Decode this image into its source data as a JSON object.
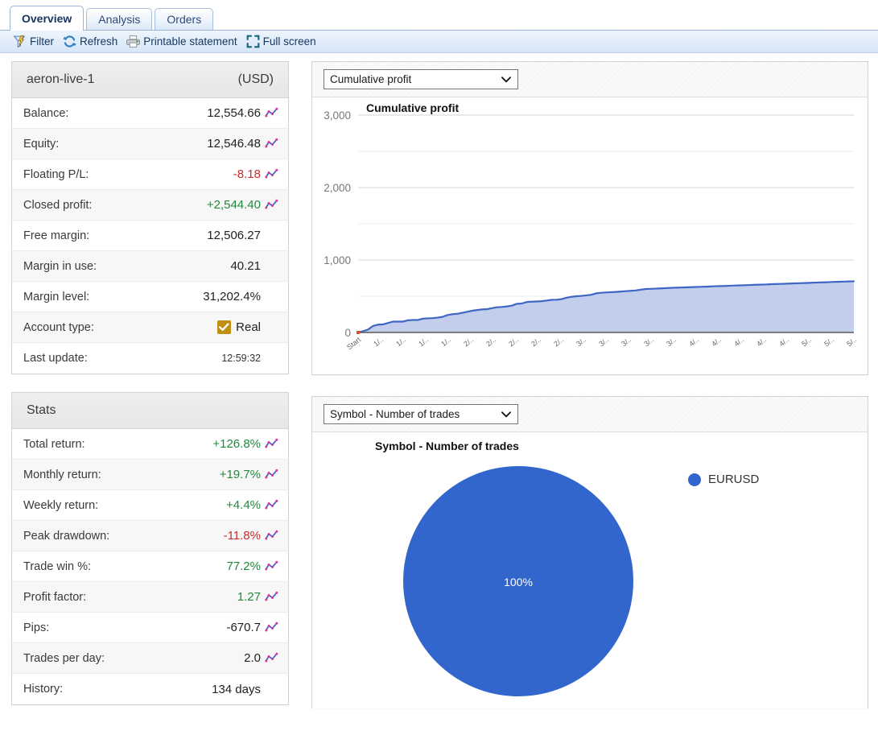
{
  "tabs": [
    {
      "label": "Overview",
      "active": true
    },
    {
      "label": "Analysis",
      "active": false
    },
    {
      "label": "Orders",
      "active": false
    }
  ],
  "toolbar": {
    "filter": "Filter",
    "refresh": "Refresh",
    "printable": "Printable statement",
    "fullscreen": "Full screen"
  },
  "account": {
    "title": "aeron-live-1",
    "currency": "(USD)",
    "rows": [
      {
        "label": "Balance:",
        "value": "12,554.66",
        "tone": "",
        "icon": true
      },
      {
        "label": "Equity:",
        "value": "12,546.48",
        "tone": "",
        "icon": true
      },
      {
        "label": "Floating P/L:",
        "value": "-8.18",
        "tone": "neg",
        "icon": true
      },
      {
        "label": "Closed profit:",
        "value": "+2,544.40",
        "tone": "pos",
        "icon": true
      },
      {
        "label": "Free margin:",
        "value": "12,506.27",
        "tone": "",
        "icon": false
      },
      {
        "label": "Margin in use:",
        "value": "40.21",
        "tone": "",
        "icon": false
      },
      {
        "label": "Margin level:",
        "value": "31,202.4%",
        "tone": "",
        "icon": false
      },
      {
        "label": "Account type:",
        "value": "Real",
        "tone": "",
        "icon": false,
        "checkbox": true
      },
      {
        "label": "Last update:",
        "value": "12:59:32",
        "tone": "",
        "icon": false,
        "small": true
      }
    ]
  },
  "stats": {
    "title": "Stats",
    "rows": [
      {
        "label": "Total return:",
        "value": "+126.8%",
        "tone": "pos",
        "icon": true
      },
      {
        "label": "Monthly return:",
        "value": "+19.7%",
        "tone": "pos",
        "icon": true
      },
      {
        "label": "Weekly return:",
        "value": "+4.4%",
        "tone": "pos",
        "icon": true
      },
      {
        "label": "Peak drawdown:",
        "value": "-11.8%",
        "tone": "neg",
        "icon": true
      },
      {
        "label": "Trade win %:",
        "value": "77.2%",
        "tone": "pos",
        "icon": true
      },
      {
        "label": "Profit factor:",
        "value": "1.27",
        "tone": "pos",
        "icon": true
      },
      {
        "label": "Pips:",
        "value": "-670.7",
        "tone": "",
        "icon": true
      },
      {
        "label": "Trades per day:",
        "value": "2.0",
        "tone": "",
        "icon": true
      },
      {
        "label": "History:",
        "value": "134 days",
        "tone": "",
        "icon": false
      }
    ]
  },
  "charts": {
    "top_select": "Cumulative profit",
    "bottom_select": "Symbol - Number of trades"
  },
  "chart_data": [
    {
      "type": "area",
      "title": "Cumulative profit",
      "xlabel": "",
      "ylabel": "",
      "ylim": [
        0,
        3000
      ],
      "yticks": [
        0,
        1000,
        2000,
        3000
      ],
      "ytick_labels": [
        "0",
        "1,000",
        "2,000",
        "3,000"
      ],
      "minor_gridlines": [
        500,
        1500,
        2500
      ],
      "grid": true,
      "legend": "none",
      "line_color": "#3f66c4",
      "fill_color": "#b7c6e8",
      "start_marker_color": "#d94f2b",
      "xtick_labels": [
        "Start",
        "1/..",
        "1/..",
        "1/..",
        "1/..",
        "2/..",
        "2/..",
        "2/..",
        "2/..",
        "2/..",
        "3/..",
        "3/..",
        "3/..",
        "3/..",
        "3/..",
        "4/..",
        "4/..",
        "4/..",
        "4/..",
        "4/..",
        "5/..",
        "5/..",
        "5/.."
      ],
      "x": [
        0,
        1,
        2,
        3,
        4,
        5,
        6,
        7,
        8,
        9,
        10,
        11,
        12,
        13,
        14,
        15,
        16,
        17,
        18,
        19,
        20,
        21,
        22,
        23,
        24,
        25,
        26,
        27,
        28,
        29,
        30,
        31,
        32,
        33,
        34,
        35,
        36,
        37,
        38,
        39,
        40,
        41,
        42,
        43,
        44,
        45,
        46,
        47,
        48,
        49,
        50,
        51,
        52,
        53,
        54,
        55,
        56,
        57,
        58,
        59,
        60,
        61,
        62,
        63,
        64,
        65,
        66,
        67,
        68,
        69,
        70,
        71,
        72,
        73,
        74,
        75,
        76,
        77,
        78,
        79,
        80,
        81,
        82,
        83,
        84,
        85,
        86,
        87,
        88,
        89,
        90,
        91,
        92,
        93,
        94,
        95,
        96,
        97,
        98,
        99,
        100
      ],
      "values": [
        0,
        18,
        40,
        90,
        108,
        112,
        130,
        150,
        150,
        150,
        168,
        172,
        172,
        190,
        195,
        198,
        205,
        215,
        240,
        252,
        258,
        272,
        285,
        300,
        310,
        318,
        322,
        335,
        348,
        352,
        360,
        370,
        395,
        400,
        420,
        425,
        428,
        432,
        440,
        450,
        452,
        460,
        478,
        492,
        500,
        505,
        512,
        520,
        540,
        548,
        552,
        556,
        560,
        565,
        570,
        575,
        580,
        590,
        600,
        602,
        605,
        608,
        612,
        615,
        618,
        620,
        622,
        625,
        628,
        630,
        632,
        635,
        638,
        640,
        642,
        645,
        648,
        650,
        652,
        655,
        658,
        660,
        662,
        665,
        668,
        670,
        672,
        675,
        678,
        680,
        682,
        685,
        688,
        690,
        692,
        695,
        698,
        700,
        702,
        704,
        706
      ]
    },
    {
      "type": "pie",
      "title": "Symbol - Number of trades",
      "labels": [
        "EURUSD"
      ],
      "values": [
        100
      ],
      "value_labels": [
        "100%"
      ],
      "colors": [
        "#3366cc"
      ],
      "legend": "right"
    }
  ]
}
